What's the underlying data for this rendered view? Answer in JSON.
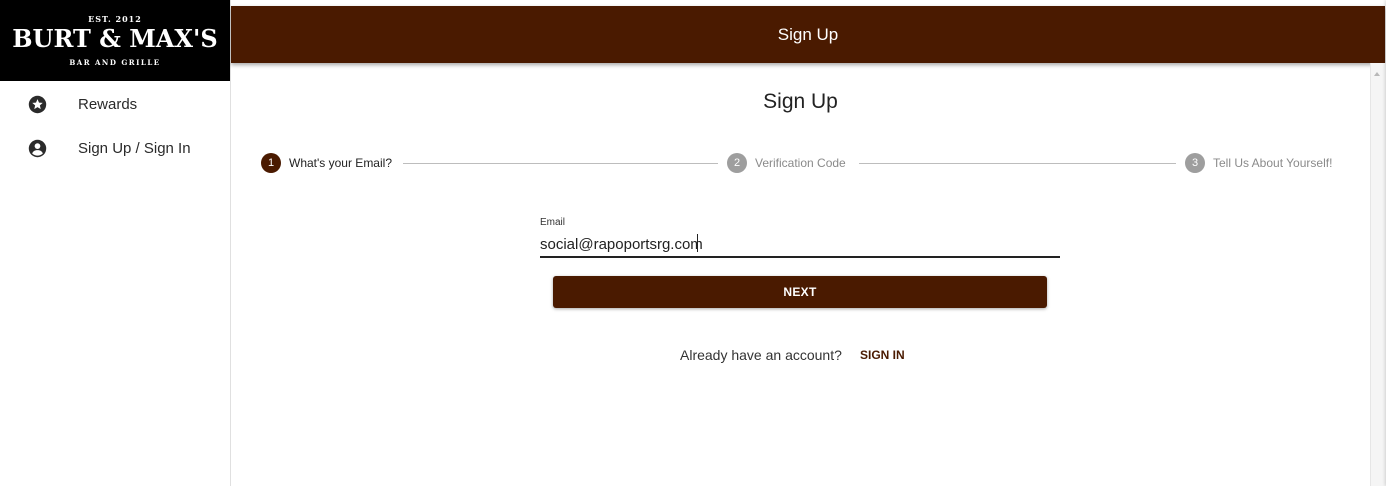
{
  "brand": {
    "est": "EST. 2012",
    "name": "BURT & MAX'S",
    "subtitle": "BAR AND GRILLE"
  },
  "sidebar": {
    "items": [
      {
        "label": "Rewards",
        "icon": "star-circle-icon"
      },
      {
        "label": "Sign Up / Sign In",
        "icon": "account-circle-icon"
      }
    ]
  },
  "header": {
    "title": "Sign Up"
  },
  "main": {
    "title": "Sign Up",
    "steps": [
      {
        "number": "1",
        "label": "What's your Email?",
        "active": true
      },
      {
        "number": "2",
        "label": "Verification Code",
        "active": false
      },
      {
        "number": "3",
        "label": "Tell Us About Yourself!",
        "active": false
      }
    ],
    "email": {
      "label": "Email",
      "value": "social@rapoportsrg.com"
    },
    "next_label": "NEXT",
    "already_text": "Already have an account?",
    "signin_label": "SIGN IN"
  },
  "colors": {
    "brand": "#4a1a00",
    "inactive_step": "#9e9e9e",
    "logo_bg": "#000000"
  }
}
